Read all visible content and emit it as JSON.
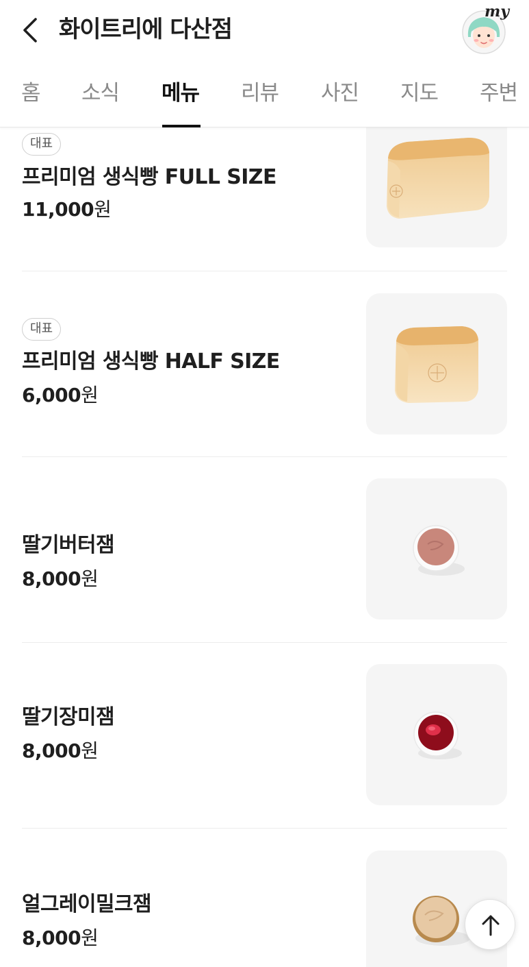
{
  "header": {
    "back_icon": "chevron-left-icon",
    "title": "화이트리에 다산점",
    "avatar_label": "my",
    "avatar_icon": "profile-avatar-icon"
  },
  "tabs": [
    {
      "label": "홈",
      "active": false
    },
    {
      "label": "소식",
      "active": false
    },
    {
      "label": "메뉴",
      "active": true
    },
    {
      "label": "리뷰",
      "active": false
    },
    {
      "label": "사진",
      "active": false
    },
    {
      "label": "지도",
      "active": false
    },
    {
      "label": "주변",
      "active": false
    }
  ],
  "menu": {
    "items": [
      {
        "badge": "대표",
        "name": "프리미엄 생식빵 FULL SIZE",
        "price": "11,000",
        "unit": "원",
        "image": "full-loaf-bread"
      },
      {
        "badge": "대표",
        "name": "프리미엄 생식빵 HALF SIZE",
        "price": "6,000",
        "unit": "원",
        "image": "half-loaf-bread"
      },
      {
        "badge": "",
        "name": "딸기버터잼",
        "price": "8,000",
        "unit": "원",
        "image": "strawberry-butter-jam"
      },
      {
        "badge": "",
        "name": "딸기장미잼",
        "price": "8,000",
        "unit": "원",
        "image": "strawberry-rose-jam"
      },
      {
        "badge": "",
        "name": "얼그레이밀크잼",
        "price": "8,000",
        "unit": "원",
        "image": "earl-grey-milk-jam"
      }
    ]
  },
  "scroll_top_icon": "arrow-up-icon",
  "colors": {
    "text": "#1f1f1f",
    "tab_inactive": "#8a8a8a",
    "tab_active": "#111111",
    "thumb_bg": "#f5f5f5",
    "separator": "#ececec"
  }
}
